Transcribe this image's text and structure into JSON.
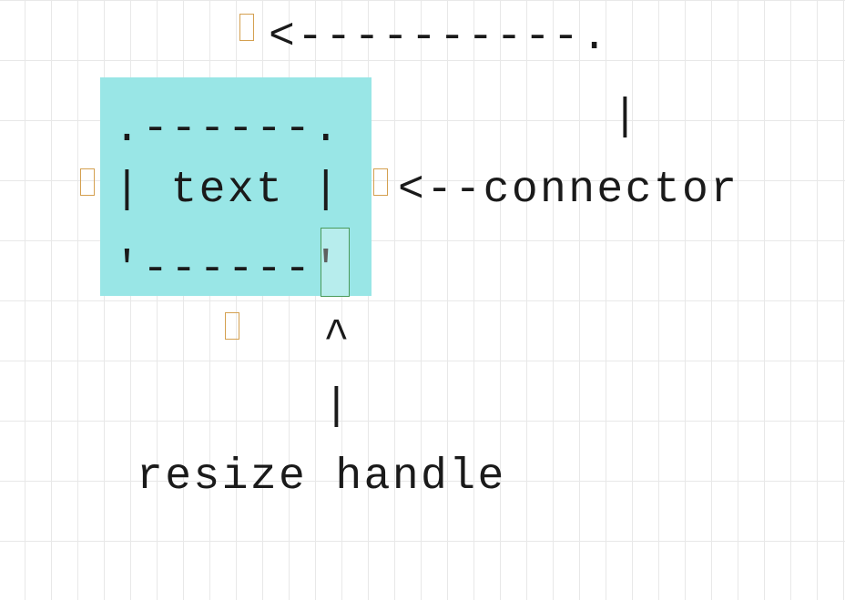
{
  "diagram": {
    "box_top": ".------.",
    "box_mid": "| text |",
    "box_bot": "'------'",
    "top_arrow": "<----------.",
    "top_right_vertical": "|",
    "connector_label": "<--connector",
    "caret": "^",
    "vertical_bar": "|",
    "resize_handle_label": "resize handle"
  },
  "colors": {
    "selection": "#99e6e6",
    "resize_handle_border": "#4a9a5a",
    "connector_indicator_border": "#d4a050",
    "grid": "#e8e8e8"
  }
}
